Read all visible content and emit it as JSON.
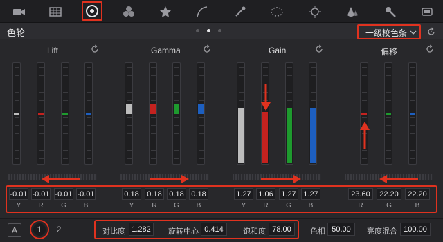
{
  "toolbar": {
    "tools": [
      "camera-icon",
      "grid-icon",
      "color-wheels-icon",
      "rgb-mixer-icon",
      "star-icon",
      "curves-icon",
      "eyedropper-icon",
      "window-icon",
      "tracker-icon",
      "blur-icon",
      "key-icon",
      "stereo-icon"
    ],
    "selected": "color-wheels-icon"
  },
  "header": {
    "title": "色轮",
    "mode_dropdown": "一级校色条",
    "page_indicator": {
      "pages": 3,
      "active": 2
    }
  },
  "wheels": [
    {
      "name": "Lift",
      "values": [
        "-0.01",
        "-0.01",
        "-0.01",
        "-0.01"
      ]
    },
    {
      "name": "Gamma",
      "values": [
        "0.18",
        "0.18",
        "0.18",
        "0.18"
      ]
    },
    {
      "name": "Gain",
      "values": [
        "1.27",
        "1.06",
        "1.27",
        "1.27"
      ]
    },
    {
      "name": "偏移",
      "values": [
        "23.60",
        "22.20",
        "22.20"
      ]
    }
  ],
  "channel_labels": [
    "Y",
    "R",
    "G",
    "B"
  ],
  "bottom": {
    "a_button": "A",
    "page1": "1",
    "page2": "2",
    "contrast_label": "对比度",
    "contrast_value": "1.282",
    "pivot_label": "旋转中心",
    "pivot_value": "0.414",
    "saturation_label": "饱和度",
    "saturation_value": "78.00",
    "hue_label": "色相",
    "hue_value": "50.00",
    "lum_mix_label": "亮度混合",
    "lum_mix_value": "100.00"
  },
  "colors": {
    "accent": "#e0321f",
    "red": "#c4221f",
    "green": "#1e9a2e",
    "blue": "#1d5fc0",
    "white": "#bdbdbd"
  }
}
